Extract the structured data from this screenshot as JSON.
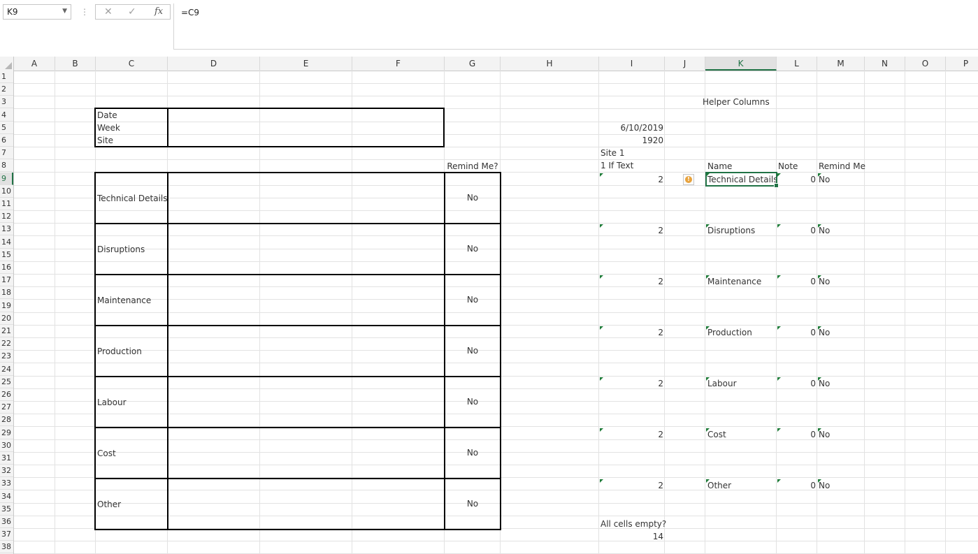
{
  "formula_bar": {
    "name_box": "K9",
    "separator": "⋮",
    "cancel_icon": "✕",
    "enter_icon": "✓",
    "function_icon": "fx",
    "formula": "=C9"
  },
  "columns": [
    "A",
    "B",
    "C",
    "D",
    "E",
    "F",
    "G",
    "H",
    "I",
    "J",
    "K",
    "L",
    "M",
    "N",
    "O",
    "P"
  ],
  "active_column": "K",
  "active_row": "9",
  "rows": [
    "1",
    "2",
    "3",
    "4",
    "5",
    "6",
    "7",
    "8",
    "9",
    "10",
    "11",
    "12",
    "13",
    "14",
    "15",
    "16",
    "17",
    "18",
    "19",
    "20",
    "21",
    "22",
    "23",
    "24",
    "25",
    "26",
    "27",
    "28",
    "29",
    "30",
    "31",
    "32",
    "33",
    "34",
    "35",
    "36",
    "37",
    "38"
  ],
  "form": {
    "header_labels": [
      "Date",
      "Week",
      "Site"
    ],
    "remind_header": "Remind Me?",
    "sections": [
      {
        "label": "Technical Details",
        "remind": "No"
      },
      {
        "label": "Disruptions",
        "remind": "No"
      },
      {
        "label": "Maintenance",
        "remind": "No"
      },
      {
        "label": "Production",
        "remind": "No"
      },
      {
        "label": "Labour",
        "remind": "No"
      },
      {
        "label": "Cost",
        "remind": "No"
      },
      {
        "label": "Other",
        "remind": "No"
      }
    ]
  },
  "helper": {
    "title": "Helper Columns",
    "date_value": "6/10/2019",
    "week_value": "1920",
    "site_value": "Site 1",
    "if_text_label": "1 If Text",
    "col_name": "Name",
    "col_note": "Note",
    "col_remind": "Remind Me",
    "rows": [
      {
        "i": "2",
        "name": "Technical Details",
        "note": "0",
        "remind": "No"
      },
      {
        "i": "2",
        "name": "Disruptions",
        "note": "0",
        "remind": "No"
      },
      {
        "i": "2",
        "name": "Maintenance",
        "note": "0",
        "remind": "No"
      },
      {
        "i": "2",
        "name": "Production",
        "note": "0",
        "remind": "No"
      },
      {
        "i": "2",
        "name": "Labour",
        "note": "0",
        "remind": "No"
      },
      {
        "i": "2",
        "name": "Cost",
        "note": "0",
        "remind": "No"
      },
      {
        "i": "2",
        "name": "Other",
        "note": "0",
        "remind": "No"
      }
    ],
    "all_empty_label": "All cells empty?",
    "all_empty_value": "14",
    "warning_icon": "!"
  }
}
